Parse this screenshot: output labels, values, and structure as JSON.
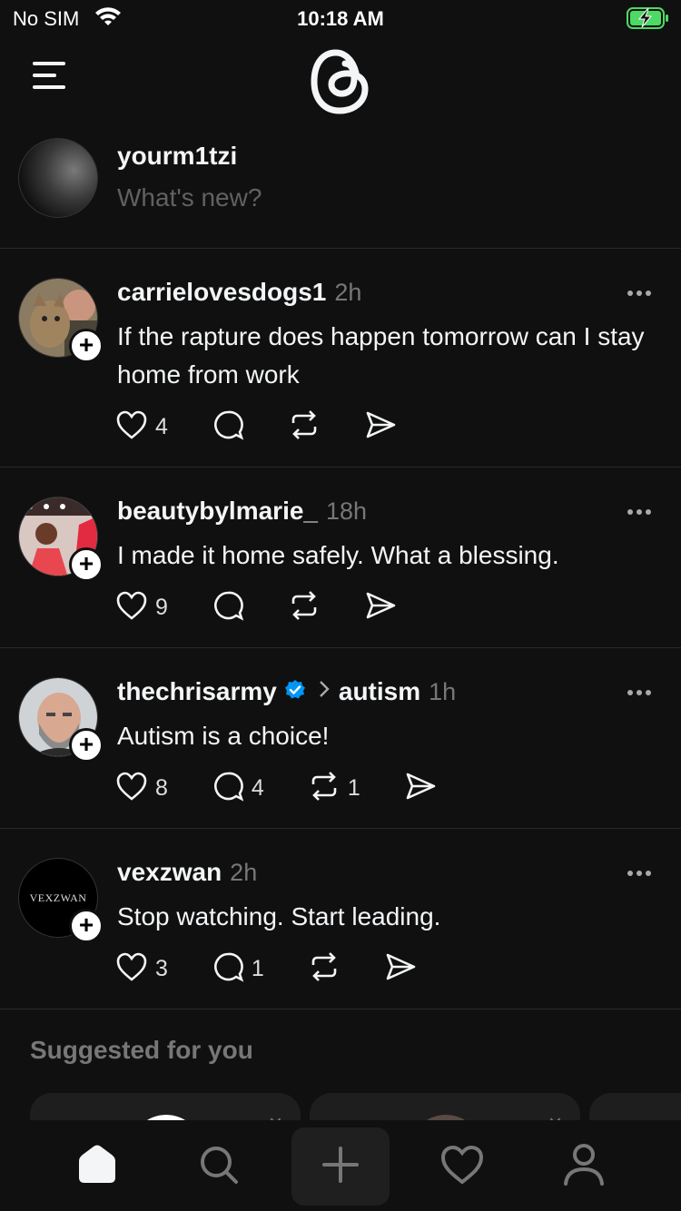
{
  "status_bar": {
    "carrier": "No SIM",
    "time": "10:18 AM",
    "battery_color": "#4cd964"
  },
  "composer": {
    "username": "yourm1tzi",
    "placeholder": "What's new?"
  },
  "posts": [
    {
      "username": "carrielovesdogs1",
      "time": "2h",
      "text": "If the rapture does happen tomorrow can I stay home from work",
      "likes": "4",
      "replies": "",
      "reposts": ""
    },
    {
      "username": "beautybylmarie_",
      "time": "18h",
      "text": "I made it home safely. What a blessing.",
      "likes": "9",
      "replies": "",
      "reposts": ""
    },
    {
      "username": "thechrisarmy",
      "verified": true,
      "topic": "autism",
      "time": "1h",
      "text": "Autism is a choice!",
      "likes": "8",
      "replies": "4",
      "reposts": "1"
    },
    {
      "username": "vexzwan",
      "time": "2h",
      "text": "Stop watching. Start leading.",
      "likes": "3",
      "replies": "1",
      "reposts": "",
      "avatar_text": "VEXZWAN"
    }
  ],
  "suggested": {
    "title": "Suggested for you",
    "dismiss_label": "×"
  },
  "icons": {
    "verified_color": "#0095f6",
    "more": "ellipsis-icon",
    "like": "heart-icon",
    "reply": "comment-icon",
    "repost": "repost-icon",
    "share": "send-icon"
  },
  "bottom_tabs": [
    "home",
    "search",
    "create",
    "activity",
    "profile"
  ]
}
